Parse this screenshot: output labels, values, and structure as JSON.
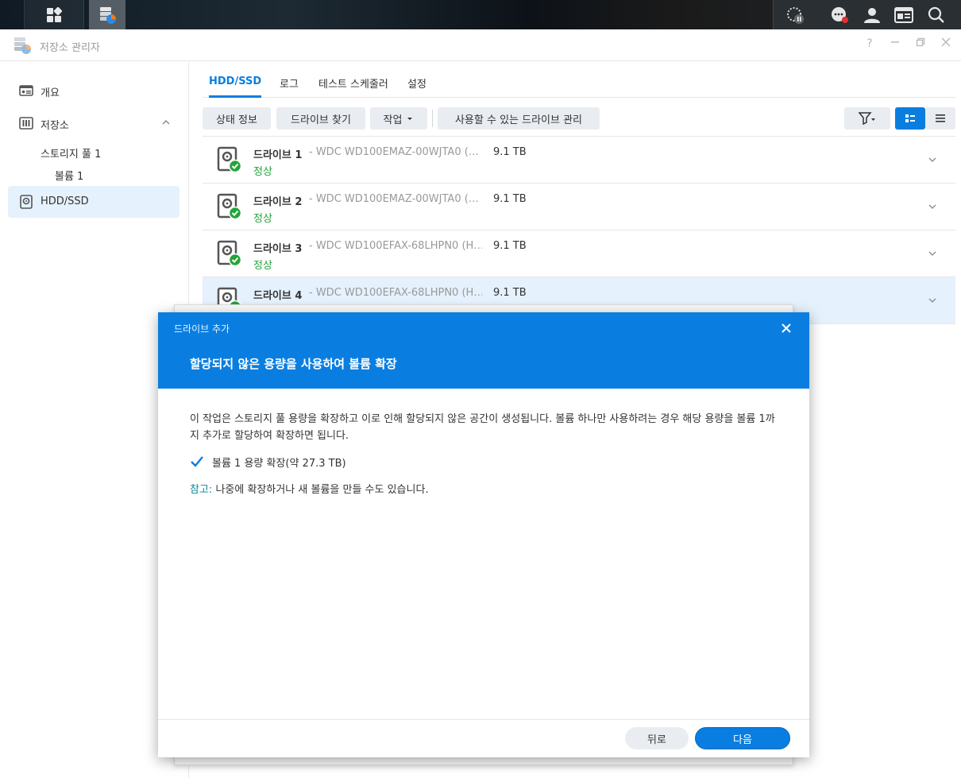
{
  "window": {
    "title": "저장소 관리자"
  },
  "sidebar": {
    "items": [
      {
        "label": "개요"
      },
      {
        "label": "저장소"
      },
      {
        "label": "HDD/SSD"
      }
    ],
    "sub": {
      "pool": "스토리지 풀 1",
      "volume": "볼륨 1"
    }
  },
  "tabs": [
    "HDD/SSD",
    "로그",
    "테스트 스케줄러",
    "설정"
  ],
  "toolbar": {
    "status_info": "상태 정보",
    "find_drive": "드라이브 찾기",
    "action": "작업",
    "manage_available": "사용할 수 있는 드라이브 관리"
  },
  "drives": [
    {
      "name": "드라이브 1",
      "model": "- WDC WD100EMAZ-00WJTA0 (…",
      "size": "9.1 TB",
      "status": "정상"
    },
    {
      "name": "드라이브 2",
      "model": "- WDC WD100EMAZ-00WJTA0 (…",
      "size": "9.1 TB",
      "status": "정상"
    },
    {
      "name": "드라이브 3",
      "model": "- WDC WD100EFAX-68LHPN0 (H…",
      "size": "9.1 TB",
      "status": "정상"
    },
    {
      "name": "드라이브 4",
      "model": "- WDC WD100EFAX-68LHPN0 (H…",
      "size": "9.1 TB",
      "status": ""
    }
  ],
  "dialog": {
    "small_title": "드라이브 추가",
    "title": "할당되지 않은 용량을 사용하여 볼륨 확장",
    "body": "이 작업은 스토리지 풀 용량을 확장하고 이로 인해 할당되지 않은 공간이 생성됩니다. 볼륨 하나만 사용하려는 경우 해당 용량을 볼륨 1까지 추가로 할당하여 확장하면 됩니다.",
    "checkbox_label": "볼륨 1 용량 확장(약 27.3 TB)",
    "checkbox_checked": true,
    "note_key": "참고:",
    "note_text": " 나중에 확장하거나 새 볼륨을 만들 수도 있습니다.",
    "back": "뒤로",
    "next": "다음"
  },
  "colors": {
    "accent": "#0a7ee0",
    "ok": "#23a43a",
    "selected_row": "#e5f1fc"
  }
}
